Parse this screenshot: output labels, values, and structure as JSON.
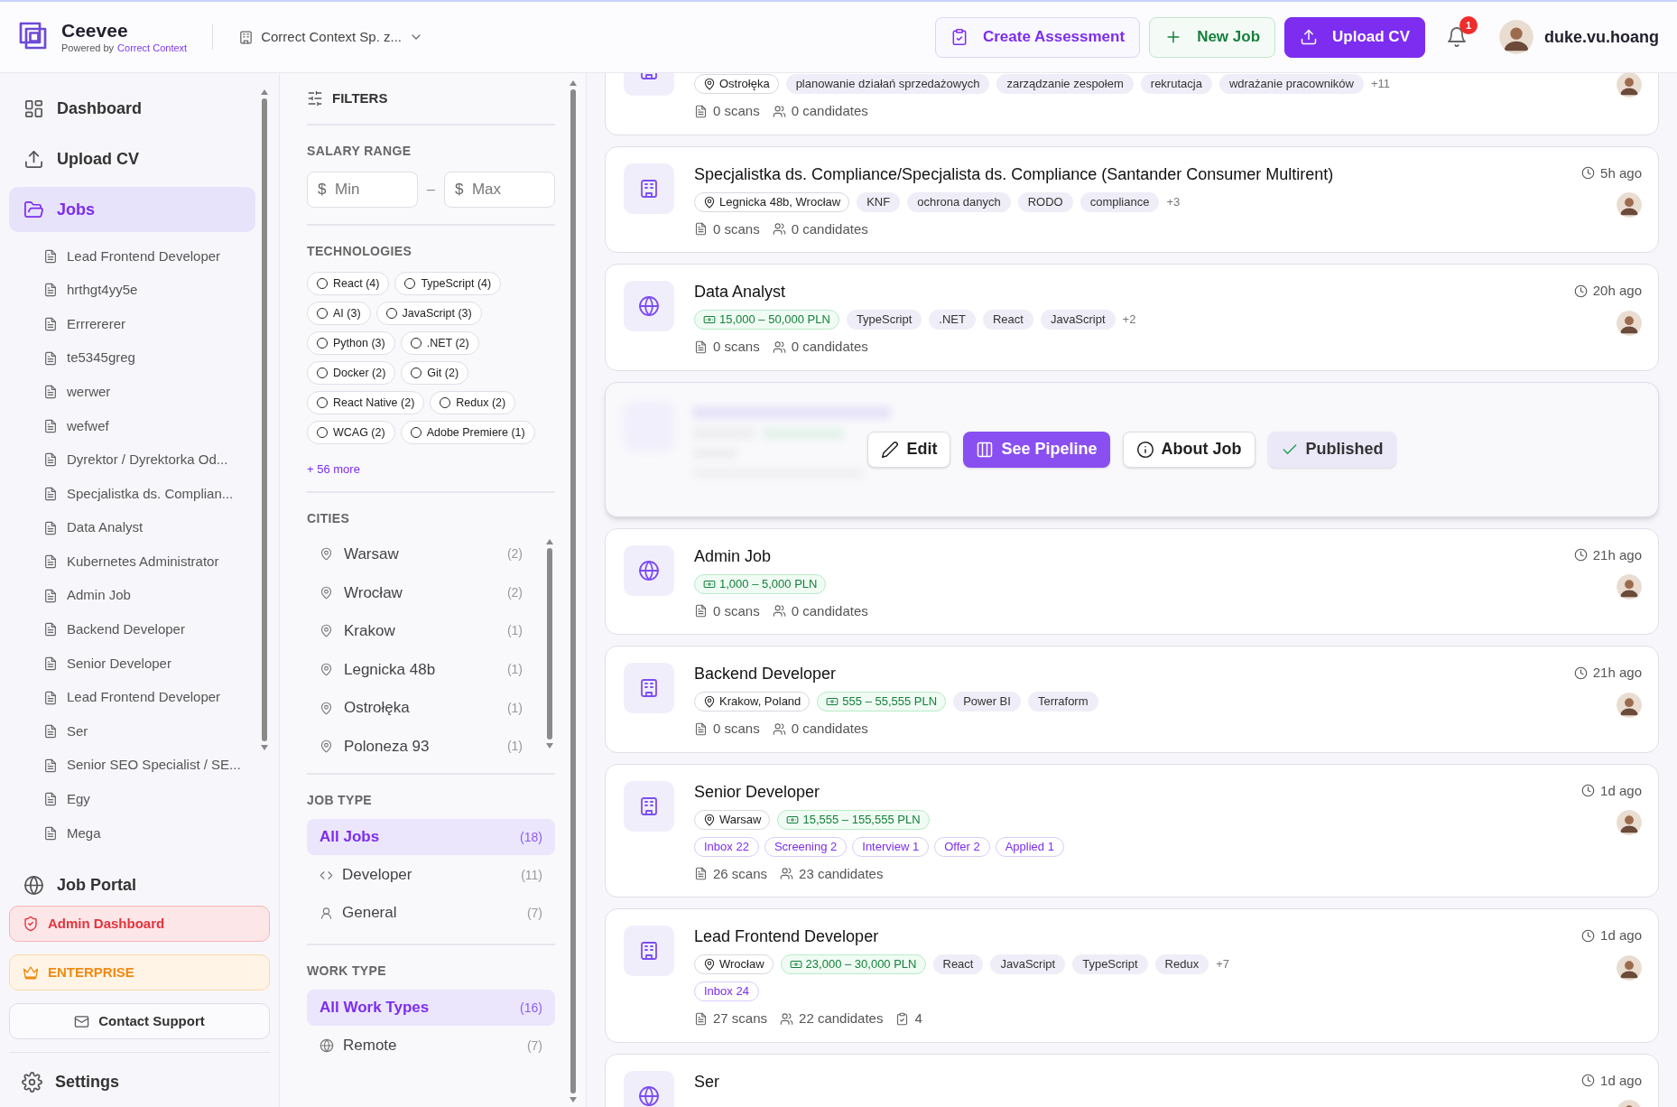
{
  "header": {
    "app_name": "Ceevee",
    "powered_by": "Powered by",
    "powered_by_link": "Correct Context",
    "company": "Correct Context Sp. z...",
    "buttons": [
      {
        "label": "Create Assessment",
        "kind": "outline"
      },
      {
        "label": "New Job",
        "kind": "success"
      },
      {
        "label": "Upload CV",
        "kind": "primary"
      }
    ],
    "notifications": "1",
    "username": "duke.vu.hoang"
  },
  "sidebar": {
    "items": [
      {
        "label": "Dashboard",
        "selected": false
      },
      {
        "label": "Upload CV",
        "selected": false
      },
      {
        "label": "Jobs",
        "selected": true,
        "children": [
          {
            "label": "Lead Frontend Developer"
          },
          {
            "label": "hrthgt4yy5e"
          },
          {
            "label": "Errrererer"
          },
          {
            "label": "te5345greg"
          },
          {
            "label": "werwer"
          },
          {
            "label": "wefwef"
          },
          {
            "label": "Dyrektor / Dyrektorka Od..."
          },
          {
            "label": "Specjalistka ds. Complian..."
          },
          {
            "label": "Data Analyst"
          },
          {
            "label": "Kubernetes Administrator"
          },
          {
            "label": "Admin Job"
          },
          {
            "label": "Backend Developer"
          },
          {
            "label": "Senior Developer"
          },
          {
            "label": "Lead Frontend Developer"
          },
          {
            "label": "Ser"
          },
          {
            "label": "Senior SEO Specialist / SE..."
          },
          {
            "label": "Egy"
          },
          {
            "label": "Mega"
          }
        ]
      },
      {
        "label": "Job Portal",
        "selected": false
      }
    ],
    "admin": "Admin Dashboard",
    "plan": "ENTERPRISE",
    "support": "Contact Support",
    "settings": "Settings"
  },
  "filters": {
    "title": "FILTERS",
    "salary": {
      "label": "SALARY RANGE",
      "min": {
        "currency": "$",
        "placeholder": "Min"
      },
      "separator": "–",
      "max": {
        "currency": "$",
        "placeholder": "Max"
      }
    },
    "technologies": {
      "label": "TECHNOLOGIES",
      "items": [
        {
          "label": "React (4)",
          "checked": false
        },
        {
          "label": "TypeScript (4)",
          "checked": false
        },
        {
          "label": "AI (3)",
          "checked": false
        },
        {
          "label": "JavaScript (3)",
          "checked": false
        },
        {
          "label": "Python (3)",
          "checked": false
        },
        {
          "label": ".NET (2)",
          "checked": false
        },
        {
          "label": "Docker (2)",
          "checked": false
        },
        {
          "label": "Git (2)",
          "checked": false
        },
        {
          "label": "React Native (2)",
          "checked": false
        },
        {
          "label": "Redux (2)",
          "checked": false
        },
        {
          "label": "WCAG (2)",
          "checked": false
        },
        {
          "label": "Adobe Premiere (1)",
          "checked": false
        }
      ],
      "more": "+ 56 more"
    },
    "cities": {
      "label": "CITIES",
      "items": [
        {
          "name": "Warsaw",
          "count": "(2)"
        },
        {
          "name": "Wrocław",
          "count": "(2)"
        },
        {
          "name": "Krakow",
          "count": "(1)"
        },
        {
          "name": "Legnicka 48b",
          "count": "(1)"
        },
        {
          "name": "Ostrołęka",
          "count": "(1)"
        },
        {
          "name": "Poloneza 93",
          "count": "(1)"
        }
      ]
    },
    "job_type": {
      "label": "JOB TYPE",
      "items": [
        {
          "name": "All Jobs",
          "count": "(18)",
          "selected": true,
          "kind": "all"
        },
        {
          "name": "Developer",
          "count": "(11)",
          "selected": false,
          "kind": "code"
        },
        {
          "name": "General",
          "count": "(7)",
          "selected": false,
          "kind": "person"
        }
      ]
    },
    "work_type": {
      "label": "WORK TYPE",
      "items": [
        {
          "name": "All Work Types",
          "count": "(16)",
          "selected": true,
          "kind": "all"
        },
        {
          "name": "Remote",
          "count": "(7)",
          "selected": false,
          "kind": "remote"
        }
      ]
    }
  },
  "jobs": [
    {
      "kind": "onsite",
      "tags": [
        {
          "text": "Ostrołęka",
          "kind": "location"
        },
        {
          "text": "planowanie działań sprzedażowych",
          "kind": "tech"
        },
        {
          "text": "zarządzanie zespołem",
          "kind": "tech"
        },
        {
          "text": "rekrutacja",
          "kind": "tech"
        },
        {
          "text": "wdrażanie pracowników",
          "kind": "tech"
        },
        {
          "text": "+11",
          "kind": "more"
        }
      ],
      "scans": "0 scans",
      "candidates": "0 candidates"
    },
    {
      "kind": "onsite",
      "title": "Specjalistka ds. Compliance/Specjalista ds. Compliance (Santander Consumer Multirent)",
      "time": "5h ago",
      "tags": [
        {
          "text": "Legnicka 48b, Wrocław",
          "kind": "location"
        },
        {
          "text": "KNF",
          "kind": "tech"
        },
        {
          "text": "ochrona danych",
          "kind": "tech"
        },
        {
          "text": "RODO",
          "kind": "tech"
        },
        {
          "text": "compliance",
          "kind": "tech"
        },
        {
          "text": "+3",
          "kind": "more"
        }
      ],
      "scans": "0 scans",
      "candidates": "0 candidates"
    },
    {
      "kind": "remote",
      "title": "Data Analyst",
      "time": "20h ago",
      "tags": [
        {
          "text": "15,000 – 50,000 PLN",
          "kind": "salary"
        },
        {
          "text": "TypeScript",
          "kind": "tech"
        },
        {
          "text": ".NET",
          "kind": "tech"
        },
        {
          "text": "React",
          "kind": "tech"
        },
        {
          "text": "JavaScript",
          "kind": "tech"
        },
        {
          "text": "+2",
          "kind": "more"
        }
      ],
      "scans": "0 scans",
      "candidates": "0 candidates"
    },
    {
      "kind": "hovered",
      "actions": [
        {
          "label": "Edit",
          "kind": "edit"
        },
        {
          "label": "See Pipeline",
          "kind": "pipeline"
        },
        {
          "label": "About Job",
          "kind": "info"
        },
        {
          "label": "Published",
          "kind": "status"
        }
      ]
    },
    {
      "kind": "remote",
      "title": "Admin Job",
      "time": "21h ago",
      "tags": [
        {
          "text": "1,000 – 5,000 PLN",
          "kind": "salary"
        }
      ],
      "scans": "0 scans",
      "candidates": "0 candidates"
    },
    {
      "kind": "onsite",
      "title": "Backend Developer",
      "time": "21h ago",
      "tags": [
        {
          "text": "Krakow, Poland",
          "kind": "location"
        },
        {
          "text": "555 – 55,555 PLN",
          "kind": "salary"
        },
        {
          "text": "Power BI",
          "kind": "tech"
        },
        {
          "text": "Terraform",
          "kind": "tech"
        }
      ],
      "scans": "0 scans",
      "candidates": "0 candidates"
    },
    {
      "kind": "onsite",
      "title": "Senior Developer",
      "time": "1d ago",
      "tags": [
        {
          "text": "Warsaw",
          "kind": "location"
        },
        {
          "text": "15,555 – 155,555 PLN",
          "kind": "salary"
        }
      ],
      "stages": [
        "Inbox 22",
        "Screening 2",
        "Interview 1",
        "Offer 2",
        "Applied 1"
      ],
      "scans": "26 scans",
      "candidates": "23 candidates"
    },
    {
      "kind": "onsite",
      "title": "Lead Frontend Developer",
      "time": "1d ago",
      "tags": [
        {
          "text": "Wrocław",
          "kind": "location"
        },
        {
          "text": "23,000 – 30,000 PLN",
          "kind": "salary"
        },
        {
          "text": "React",
          "kind": "tech"
        },
        {
          "text": "JavaScript",
          "kind": "tech"
        },
        {
          "text": "TypeScript",
          "kind": "tech"
        },
        {
          "text": "Redux",
          "kind": "tech"
        },
        {
          "text": "+7",
          "kind": "more"
        }
      ],
      "stages": [
        "Inbox 24"
      ],
      "scans": "27 scans",
      "candidates": "22 candidates",
      "assessments": "4"
    },
    {
      "kind": "remote",
      "title": "Ser",
      "time": "1d ago"
    }
  ]
}
